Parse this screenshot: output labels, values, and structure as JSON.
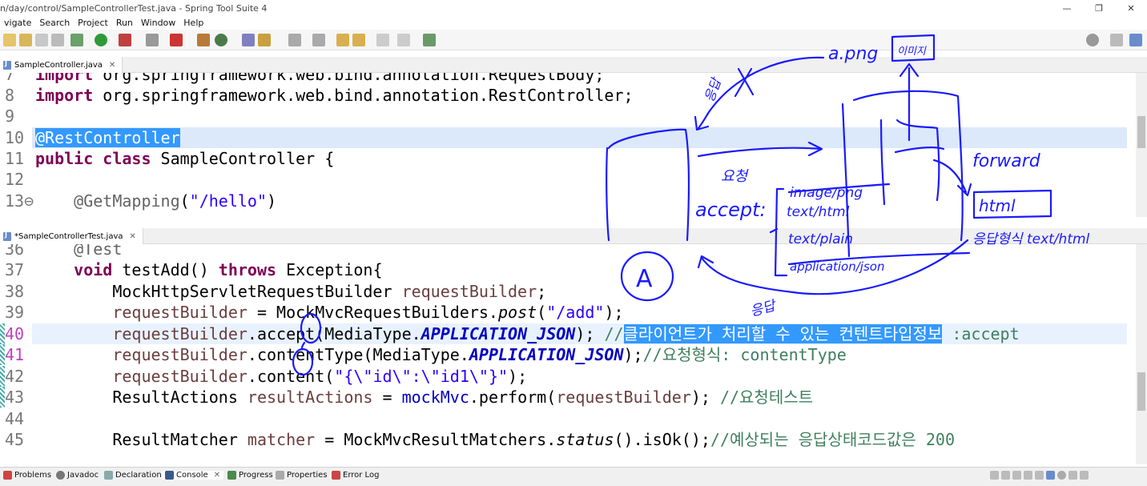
{
  "window": {
    "title": "n/day/control/SampleControllerTest.java - Spring Tool Suite 4",
    "minimize": "—",
    "maximize": "❐",
    "close": "✕"
  },
  "menu": [
    "vigate",
    "Search",
    "Project",
    "Run",
    "Window",
    "Help"
  ],
  "top_editor": {
    "tab_label": "SampleController.java",
    "lines": [
      {
        "num": "7",
        "code": "import org.springframework.web.bind.annotation.RequestBody;"
      },
      {
        "num": "8",
        "code": "import org.springframework.web.bind.annotation.RestController;"
      },
      {
        "num": "9",
        "code": ""
      },
      {
        "num": "10",
        "code": "@RestController"
      },
      {
        "num": "11",
        "code": "public class SampleController {"
      },
      {
        "num": "12",
        "code": ""
      },
      {
        "num": "13⊖",
        "code": "    @GetMapping(\"/hello\")"
      }
    ]
  },
  "bottom_editor": {
    "tab_label": "*SampleControllerTest.java",
    "lines": [
      {
        "num": "36",
        "code": "    @Test"
      },
      {
        "num": "37",
        "code": "    void testAdd() throws Exception{"
      },
      {
        "num": "38",
        "code": "        MockHttpServletRequestBuilder requestBuilder;"
      },
      {
        "num": "39",
        "code": "        requestBuilder = MockMvcRequestBuilders.post(\"/add\");"
      },
      {
        "num": "40",
        "code": "        requestBuilder.accept(MediaType.APPLICATION_JSON); //클라이언트가 처리할 수 있는 컨텐트타입정보 :accept"
      },
      {
        "num": "41",
        "code": "        requestBuilder.contentType(MediaType.APPLICATION_JSON);//요청형식: contentType"
      },
      {
        "num": "42",
        "code": "        requestBuilder.content(\"{\\\"id\\\":\\\"id1\\\"}\");"
      },
      {
        "num": "43",
        "code": "        ResultActions resultActions = mockMvc.perform(requestBuilder); //요청테스트"
      },
      {
        "num": "44",
        "code": ""
      },
      {
        "num": "45",
        "code": "        ResultMatcher matcher = MockMvcResultMatchers.status().isOk();//예상되는 응답상태코드값은 200"
      }
    ]
  },
  "bottom_tabs": [
    "Problems",
    "Javadoc",
    "Declaration",
    "Console",
    "Progress",
    "Properties",
    "Error Log"
  ],
  "annotations": {
    "ink_color": "#1a1aff",
    "a_png": "a.png",
    "image_box": "이미지",
    "eungdap_top": "응답",
    "yocheong": "요청",
    "accept": "accept:",
    "image_png": "image/png",
    "text_html": "text/html",
    "text_plain": "text/plain",
    "application_json": "application/json",
    "forward": "forward",
    "html_box": "html",
    "response_format": "응답형식 text/html",
    "circle_a": "A",
    "eungdap_bottom": "응답"
  }
}
